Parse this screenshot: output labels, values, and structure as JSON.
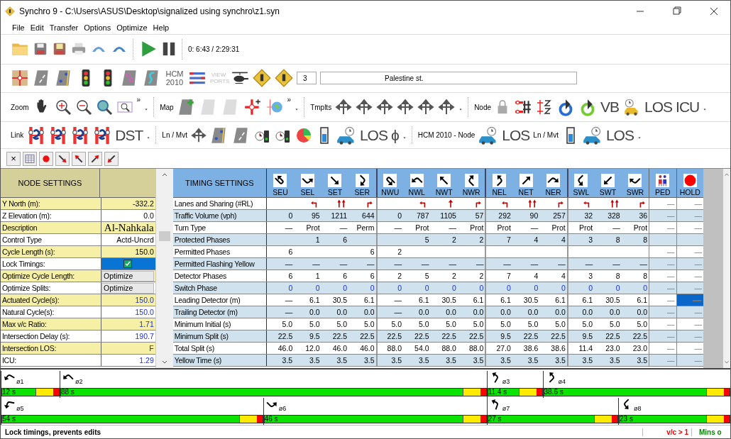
{
  "window": {
    "title": "Synchro 9 - C:\\Users\\ASUS\\Desktop\\signalized using synchro\\z1.syn"
  },
  "menu": [
    "File",
    "Edit",
    "Transfer",
    "Options",
    "Optimize",
    "Help"
  ],
  "toolbar_main": {
    "time": "0: 6:43 /  2:29:31"
  },
  "toolbar_views": {
    "hcm_label": "HCM 2010",
    "viewports_label": "VIEW PORTS",
    "node_number": "3",
    "node_name": "Palestine st."
  },
  "toolbar_zoom": {
    "zoom_label": "Zoom",
    "more": "»",
    "map_label": "Map",
    "more_map": "»",
    "templates_label": "Tmplts",
    "node_label": "Node",
    "vb": "VB",
    "los": "LOS",
    "icu": "ICU"
  },
  "toolbar_link": {
    "link_label": "Link",
    "dst": "DST",
    "ln_mvt_label": "Ln / Mvt",
    "los": "LOS",
    "phi": "ϕ",
    "hcm_node_label": "HCM 2010 - Node",
    "los_node": "LOS",
    "ln_mvt_label_2": "Ln / Mvt",
    "los_lane": "LOS"
  },
  "toolbar_small": {
    "close": "×"
  },
  "node_settings": {
    "title": "NODE SETTINGS",
    "rows": [
      {
        "label": "Y North (m):",
        "kind": "input",
        "value": "-332.2",
        "selected": false
      },
      {
        "label": "Z Elevation (m):",
        "kind": "input",
        "value": "0.0",
        "selected": false
      },
      {
        "label": "Description",
        "kind": "description",
        "value": "Al-Nahkala",
        "selected": false
      },
      {
        "label": "Control Type",
        "kind": "input",
        "value": "Actd-Uncrd",
        "selected": false
      },
      {
        "label": "Cycle Length (s):",
        "kind": "input",
        "value": "150.0",
        "selected": false
      },
      {
        "label": "Lock Timings:",
        "kind": "checkbox",
        "checked": true,
        "selected": true
      },
      {
        "label": "Optimize Cycle Length:",
        "kind": "button",
        "value": "Optimize",
        "selected": false
      },
      {
        "label": "Optimize Splits:",
        "kind": "button",
        "value": "Optimize",
        "selected": false
      },
      {
        "label": "Actuated Cycle(s):",
        "kind": "calc",
        "value": "150.0",
        "selected": false
      },
      {
        "label": "Natural Cycle(s):",
        "kind": "calc",
        "value": "150.0",
        "selected": false
      },
      {
        "label": "Max v/c Ratio:",
        "kind": "calc",
        "value": "1.71",
        "selected": false
      },
      {
        "label": "Intersection Delay (s):",
        "kind": "calc",
        "value": "190.7",
        "selected": false
      },
      {
        "label": "Intersection LOS:",
        "kind": "calc",
        "value": "F",
        "selected": false
      },
      {
        "label": "ICU:",
        "kind": "calc",
        "value": "1.29",
        "selected": false
      }
    ]
  },
  "timing_settings": {
    "title": "TIMING SETTINGS",
    "columns": [
      {
        "label": "SEU",
        "kind": "u-turn",
        "group_start": false
      },
      {
        "label": "SEL",
        "kind": "left",
        "group_start": false
      },
      {
        "label": "SET",
        "kind": "through",
        "group_start": false
      },
      {
        "label": "SER",
        "kind": "right",
        "group_start": false
      },
      {
        "label": "NWU",
        "kind": "u-turn",
        "group_start": true
      },
      {
        "label": "NWL",
        "kind": "left",
        "group_start": false
      },
      {
        "label": "NWT",
        "kind": "through",
        "group_start": false
      },
      {
        "label": "NWR",
        "kind": "right",
        "group_start": false
      },
      {
        "label": "NEL",
        "kind": "left",
        "group_start": true
      },
      {
        "label": "NET",
        "kind": "through",
        "group_start": false
      },
      {
        "label": "NER",
        "kind": "right",
        "group_start": false
      },
      {
        "label": "SWL",
        "kind": "left",
        "group_start": true
      },
      {
        "label": "SWT",
        "kind": "through",
        "group_start": false
      },
      {
        "label": "SWR",
        "kind": "right",
        "group_start": false
      },
      {
        "label": "PED",
        "kind": "ped",
        "group_start": true
      },
      {
        "label": "HOLD",
        "kind": "hold",
        "group_start": true
      }
    ],
    "rows": [
      {
        "label": "Lanes and Sharing (#RL)",
        "kind": "lanes",
        "cells": [
          null,
          {
            "kind": "left-turn"
          },
          {
            "kind": "two-through"
          },
          {
            "kind": "right-turn"
          },
          null,
          {
            "kind": "left-turn"
          },
          {
            "kind": "one-through"
          },
          {
            "kind": "right-turn"
          },
          {
            "kind": "left-turn"
          },
          {
            "kind": "two-through"
          },
          {
            "kind": "right-turn"
          },
          {
            "kind": "left-turn"
          },
          {
            "kind": "two-through"
          },
          {
            "kind": "right-turn"
          },
          {
            "kind": "text",
            "text": "—"
          },
          {
            "kind": "text",
            "text": "—"
          }
        ]
      },
      {
        "label": "Traffic Volume (vph)",
        "kind": "input",
        "cells": [
          "0",
          "95",
          "1211",
          "644",
          "0",
          "787",
          "1105",
          "57",
          "292",
          "90",
          "257",
          "32",
          "328",
          "36",
          "—",
          "—"
        ]
      },
      {
        "label": "Turn Type",
        "kind": "input",
        "cells": [
          "—",
          "Prot",
          "—",
          "Perm",
          "—",
          "Prot",
          "—",
          "Prot",
          "Prot",
          "—",
          "Prot",
          "Prot",
          "—",
          "Prot",
          "—",
          "—"
        ]
      },
      {
        "label": "Protected Phases",
        "kind": "input",
        "cells": [
          null,
          "1",
          "6",
          null,
          null,
          "5",
          "2",
          "2",
          "7",
          "4",
          "4",
          "3",
          "8",
          "8",
          null,
          null
        ]
      },
      {
        "label": "Permitted Phases",
        "kind": "input",
        "cells": [
          "6",
          null,
          null,
          "6",
          "2",
          null,
          null,
          null,
          null,
          null,
          null,
          null,
          null,
          null,
          "—",
          "—"
        ]
      },
      {
        "label": "Permitted Flashing Yellow",
        "kind": "input",
        "cells": [
          "—",
          "—",
          "—",
          "—",
          "—",
          "—",
          "—",
          "—",
          "—",
          "—",
          "—",
          "—",
          "—",
          "—",
          "—",
          "—"
        ]
      },
      {
        "label": "Detector Phases",
        "kind": "input",
        "cells": [
          "6",
          "1",
          "6",
          "6",
          "2",
          "5",
          "2",
          "2",
          "7",
          "4",
          "4",
          "3",
          "8",
          "8",
          "—",
          "—"
        ]
      },
      {
        "label": "Switch Phase",
        "kind": "calc",
        "cells": [
          "0",
          "0",
          "0",
          "0",
          "0",
          "0",
          "0",
          "0",
          "0",
          "0",
          "0",
          "0",
          "0",
          "0",
          "—",
          "—"
        ]
      },
      {
        "label": "Leading Detector (m)",
        "kind": "input",
        "cells": [
          "—",
          "6.1",
          "30.5",
          "6.1",
          "—",
          "6.1",
          "30.5",
          "6.1",
          "6.1",
          "30.5",
          "6.1",
          "6.1",
          "30.5",
          "6.1",
          "—",
          {
            "text": "—",
            "selected": true
          }
        ]
      },
      {
        "label": "Trailing Detector (m)",
        "kind": "input",
        "cells": [
          "—",
          "0.0",
          "0.0",
          "0.0",
          "—",
          "0.0",
          "0.0",
          "0.0",
          "0.0",
          "0.0",
          "0.0",
          "0.0",
          "0.0",
          "0.0",
          "—",
          "—"
        ]
      },
      {
        "label": "Minimum Initial (s)",
        "kind": "input",
        "cells": [
          "5.0",
          "5.0",
          "5.0",
          "5.0",
          "5.0",
          "5.0",
          "5.0",
          "5.0",
          "5.0",
          "5.0",
          "5.0",
          "5.0",
          "5.0",
          "5.0",
          "—",
          "—"
        ]
      },
      {
        "label": "Minimum Split (s)",
        "kind": "input",
        "cells": [
          "22.5",
          "9.5",
          "22.5",
          "22.5",
          "22.5",
          "22.5",
          "22.5",
          "22.5",
          "9.5",
          "22.5",
          "22.5",
          "9.5",
          "22.5",
          "22.5",
          "—",
          "—"
        ]
      },
      {
        "label": "Total Split (s)",
        "kind": "input",
        "cells": [
          "46.0",
          "12.0",
          "46.0",
          "46.0",
          "88.0",
          "54.0",
          "88.0",
          "88.0",
          "27.0",
          "38.6",
          "38.6",
          "11.4",
          "23.0",
          "23.0",
          "—",
          "—"
        ]
      },
      {
        "label": "Yellow Time (s)",
        "kind": "input",
        "cells": [
          "3.5",
          "3.5",
          "3.5",
          "3.5",
          "3.5",
          "3.5",
          "3.5",
          "3.5",
          "3.5",
          "3.5",
          "3.5",
          "3.5",
          "3.5",
          "3.5",
          "—",
          "—"
        ]
      }
    ]
  },
  "splits": [
    {
      "phases": [
        {
          "label": "ø1",
          "duration": "12 s"
        },
        {
          "label": "ø2",
          "duration": "88 s"
        },
        {
          "label": "ø3",
          "duration": "11.4 s"
        },
        {
          "label": "ø4",
          "duration": "38.6 s"
        }
      ]
    },
    {
      "phases": [
        {
          "label": "ø5",
          "duration": "54 s"
        },
        {
          "label": "ø6",
          "duration": "46 s"
        },
        {
          "label": "ø7",
          "duration": "27 s"
        },
        {
          "label": "ø8",
          "duration": "23 s"
        }
      ]
    }
  ],
  "status_bar": {
    "message": "Lock timings, prevents edits",
    "warning": "v/c > 1",
    "ok": "Mins o"
  }
}
